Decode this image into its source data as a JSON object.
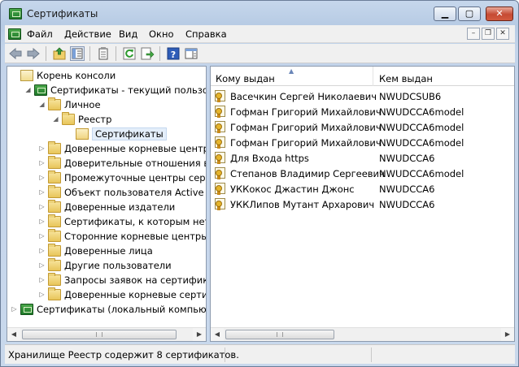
{
  "window": {
    "title": "Сертификаты",
    "minimize_glyph": "▁",
    "maximize_glyph": "▢",
    "close_glyph": "✕"
  },
  "menubar": {
    "items": [
      {
        "label": "Файл"
      },
      {
        "label": "Действие"
      },
      {
        "label": "Вид"
      },
      {
        "label": "Окно"
      },
      {
        "label": "Справка"
      }
    ],
    "mdi_minimize": "–",
    "mdi_restore": "❐",
    "mdi_close": "✕"
  },
  "toolbar": {
    "buttons": [
      "back-icon",
      "forward-icon",
      "up-folder-icon",
      "show-tree-icon",
      "properties-icon",
      "refresh-icon",
      "export-list-icon",
      "help-icon",
      "action-pane-icon"
    ]
  },
  "tree": {
    "items": [
      {
        "label": "Корень консоли",
        "icon": "console-root-icon",
        "expander": ""
      },
      {
        "label": "Сертификаты - текущий пользовате",
        "icon": "certificates-snapin-icon",
        "expander": "◢"
      },
      {
        "label": "Личное",
        "icon": "folder-icon",
        "expander": "◢"
      },
      {
        "label": "Реестр",
        "icon": "folder-icon",
        "expander": "◢"
      },
      {
        "label": "Сертификаты",
        "icon": "folder-open-icon",
        "expander": "",
        "selected": true
      },
      {
        "label": "Доверенные корневые центры с",
        "icon": "folder-icon",
        "expander": "▷"
      },
      {
        "label": "Доверительные отношения в пр",
        "icon": "folder-icon",
        "expander": "▷"
      },
      {
        "label": "Промежуточные центры сертиф",
        "icon": "folder-icon",
        "expander": "▷"
      },
      {
        "label": "Объект пользователя Active Direc",
        "icon": "folder-icon",
        "expander": "▷"
      },
      {
        "label": "Доверенные издатели",
        "icon": "folder-icon",
        "expander": "▷"
      },
      {
        "label": "Сертификаты, к которым нет до",
        "icon": "folder-icon",
        "expander": "▷"
      },
      {
        "label": "Сторонние корневые центры сер",
        "icon": "folder-icon",
        "expander": "▷"
      },
      {
        "label": "Доверенные лица",
        "icon": "folder-icon",
        "expander": "▷"
      },
      {
        "label": "Другие пользователи",
        "icon": "folder-icon",
        "expander": "▷"
      },
      {
        "label": "Запросы заявок на сертификат",
        "icon": "folder-icon",
        "expander": "▷"
      },
      {
        "label": "Доверенные корневые сертифик",
        "icon": "folder-icon",
        "expander": "▷"
      },
      {
        "label": "Сертификаты (локальный компьюте",
        "icon": "certificates-snapin-icon",
        "expander": "▷"
      }
    ]
  },
  "list": {
    "columns": [
      {
        "label": "Кому выдан",
        "sort_glyph": "▲"
      },
      {
        "label": "Кем выдан"
      }
    ],
    "rows": [
      {
        "issued_to": "Васечкин Сергей Николаевич",
        "issued_by": "NWUDCSUB6"
      },
      {
        "issued_to": "Гофман Григорий Михайлович",
        "issued_by": "NWUDCCA6model"
      },
      {
        "issued_to": "Гофман Григорий Михайлович",
        "issued_by": "NWUDCCA6model"
      },
      {
        "issued_to": "Гофман Григорий Михайлович",
        "issued_by": "NWUDCCA6model"
      },
      {
        "issued_to": "Для Входа https",
        "issued_by": "NWUDCCA6"
      },
      {
        "issued_to": "Степанов Владимир Сергеевич",
        "issued_by": "NWUDCCA6model"
      },
      {
        "issued_to": "УККокос Джастин Джонс",
        "issued_by": "NWUDCCA6"
      },
      {
        "issued_to": "УККЛипов Мутант Архарович",
        "issued_by": "NWUDCCA6"
      }
    ]
  },
  "scrollbars": {
    "left_arrow": "◀",
    "right_arrow": "▶"
  },
  "statusbar": {
    "text": "Хранилище Реестр содержит 8 сертификатов."
  }
}
